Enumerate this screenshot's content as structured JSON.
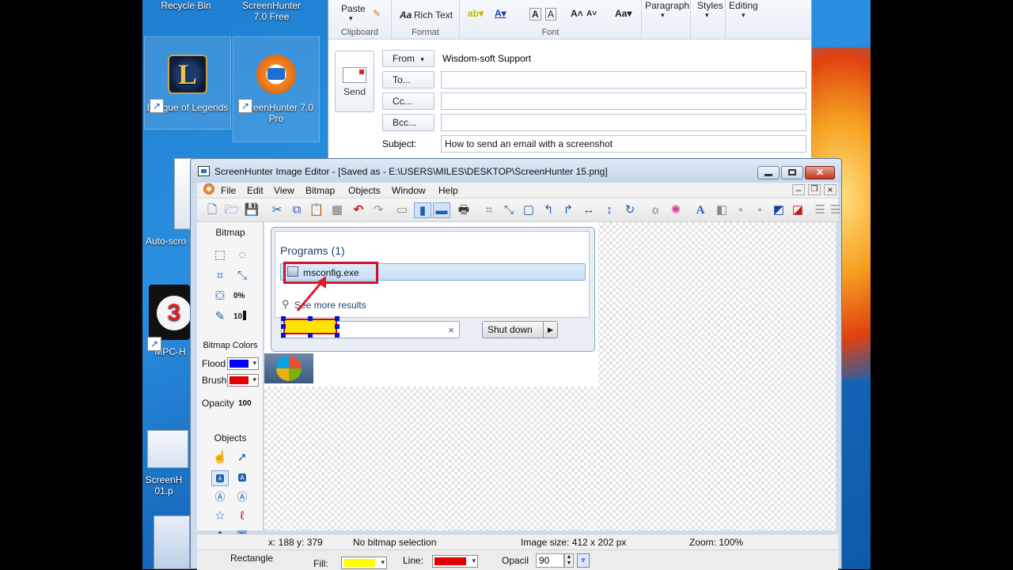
{
  "desktop": {
    "icons": [
      {
        "label": "Recycle Bin"
      },
      {
        "label": "ScreenHunter 7.0 Free"
      },
      {
        "label": "League of Legends"
      },
      {
        "label": "ScreenHunter 7.0 Pro"
      },
      {
        "label": "Auto-scro"
      },
      {
        "label": "MPC-H"
      },
      {
        "label": "ScreenH 01.p"
      }
    ]
  },
  "outlook": {
    "ribbon": {
      "paste": "Paste",
      "rich_text": "Rich Text",
      "paragraph": "Paragraph",
      "styles": "Styles",
      "editing": "Editing",
      "groups": [
        "Clipboard",
        "Format",
        "Font"
      ]
    },
    "send_label": "Send",
    "from_label": "From",
    "from_value": "Wisdom-soft Support",
    "to_label": "To...",
    "cc_label": "Cc...",
    "bcc_label": "Bcc...",
    "subject_label": "Subject:",
    "subject_value": "How to send an email with a screenshot"
  },
  "editor": {
    "title": "ScreenHunter Image Editor - [Saved as - E:\\USERS\\MILES\\DESKTOP\\ScreenHunter 15.png]",
    "menu": [
      "File",
      "Edit",
      "View",
      "Bitmap",
      "Objects",
      "Window",
      "Help"
    ],
    "left_panel": {
      "bitmap_title": "Bitmap",
      "zero_pct": "0%",
      "ten": "10",
      "colors_title": "Bitmap Colors",
      "flood_label": "Flood",
      "flood_color": "#0000ff",
      "brush_label": "Brush",
      "brush_color": "#e00000",
      "opacity_label": "Opacity",
      "opacity_value": "100",
      "objects_title": "Objects"
    },
    "canvas": {
      "programs_label": "Programs (1)",
      "program_item": "msconfig.exe",
      "see_more": "See more results",
      "search_clear": "×",
      "shutdown_label": "Shut down"
    },
    "status": {
      "coords": "x: 188 y: 379",
      "selection": "No bitmap selection",
      "image_size": "Image size: 412 x 202 px",
      "zoom": "Zoom: 100%"
    },
    "props": {
      "shape": "Rectangle",
      "fill_label": "Fill:",
      "fill_color": "#ffff00",
      "line_label": "Line:",
      "line_color": "#e00000",
      "opacity_label": "Opacil",
      "opacity_value": "90"
    }
  }
}
